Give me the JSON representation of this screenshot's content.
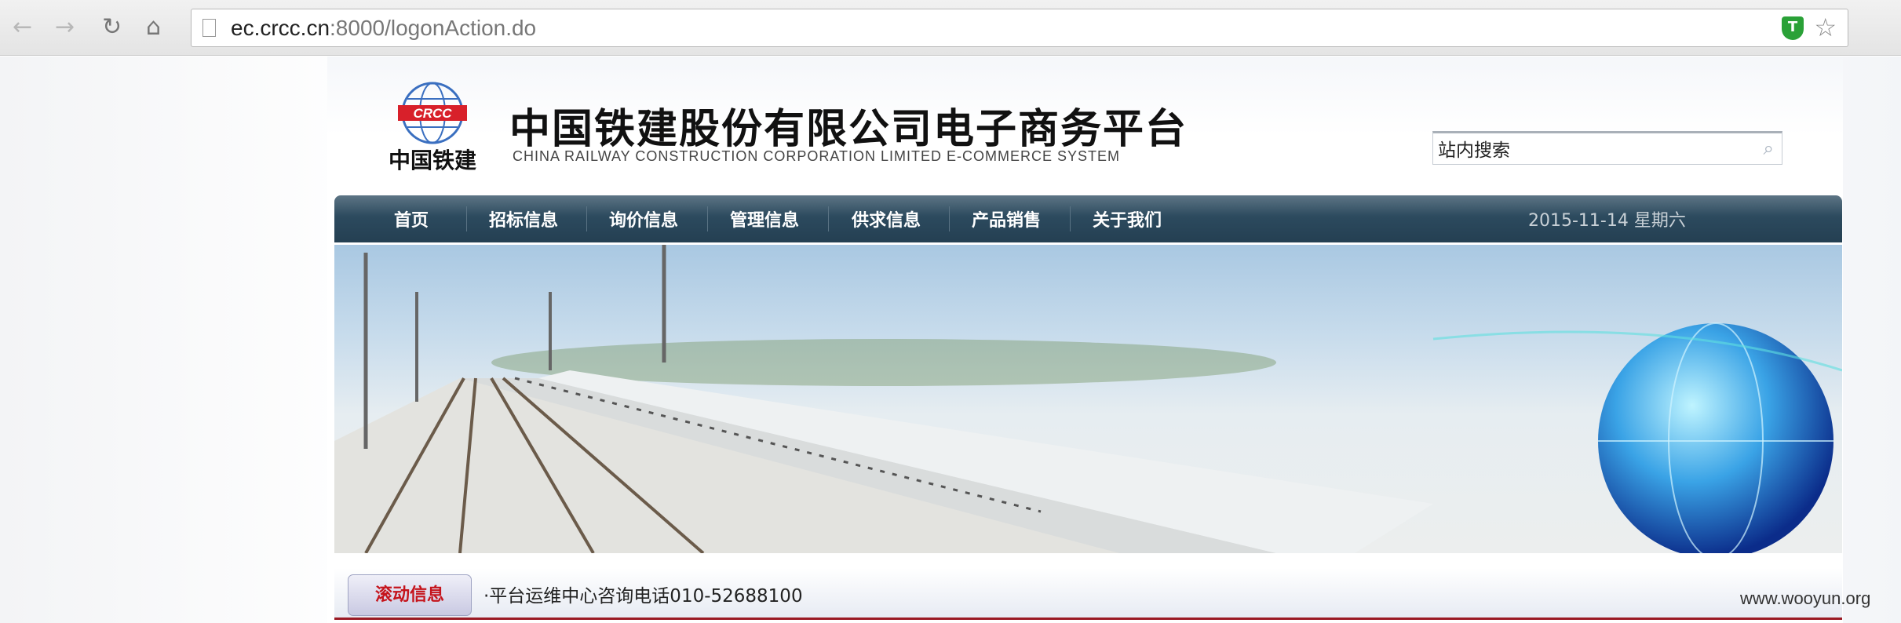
{
  "browser": {
    "url_host": "ec.crcc.cn",
    "url_rest": ":8000/logonAction.do",
    "extension_label": "T"
  },
  "header": {
    "logo_text": "CRCC",
    "logo_caption": "中国铁建",
    "title": "中国铁建股份有限公司电子商务平台",
    "subtitle": "CHINA RAILWAY CONSTRUCTION CORPORATION LIMITED E-COMMERCE SYSTEM",
    "search_value": "站内搜索"
  },
  "nav": {
    "items": [
      "首页",
      "招标信息",
      "询价信息",
      "管理信息",
      "供求信息",
      "产品销售",
      "关于我们"
    ],
    "date": "2015-11-14 星期六"
  },
  "notice": {
    "label": "滚动信息",
    "message": "·平台运维中心咨询电话010-52688100"
  },
  "watermark": "www.wooyun.org"
}
